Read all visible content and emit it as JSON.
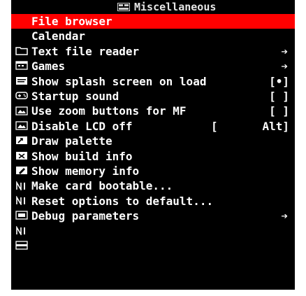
{
  "title": "Miscellaneous",
  "colors": {
    "selected_bg": "#ff0000",
    "screen_bg": "#000000",
    "text": "#ffffff"
  },
  "menu": [
    {
      "label": "File browser",
      "icon": "folder-icon",
      "value": "",
      "arrow": false,
      "selected": true
    },
    {
      "label": "Calendar",
      "icon": "calendar-icon",
      "value": "",
      "arrow": false
    },
    {
      "label": "Text file reader",
      "icon": "document-icon",
      "value": "",
      "arrow": true
    },
    {
      "label": "Games",
      "icon": "gamepad-icon",
      "value": "",
      "arrow": true
    },
    {
      "label": "Show splash screen on load",
      "icon": "image-icon",
      "value": "[•]",
      "arrow": false
    },
    {
      "label": "Startup sound",
      "icon": "image-icon",
      "value": "[ ]",
      "arrow": false
    },
    {
      "label": "Use zoom buttons for MF",
      "icon": "zoom-icon",
      "value": "[ ]",
      "arrow": false
    },
    {
      "label": "Disable LCD off",
      "icon": "lcd-icon",
      "value": "[",
      "value2": "Alt]",
      "arrow": false
    },
    {
      "label": "Draw palette",
      "icon": "palette-icon",
      "value": "",
      "arrow": false
    },
    {
      "label": "Show build info",
      "icon": "info-icon",
      "value": "",
      "arrow": false
    },
    {
      "label": "Show memory info",
      "icon": "info-icon",
      "value": "",
      "arrow": false
    },
    {
      "label": "Make card bootable...",
      "icon": "card-icon",
      "value": "",
      "arrow": false
    },
    {
      "label": "Reset options to default...",
      "icon": "info-icon",
      "value": "",
      "arrow": false
    },
    {
      "label": "Debug parameters",
      "icon": "debug-icon",
      "value": "",
      "arrow": true
    }
  ]
}
